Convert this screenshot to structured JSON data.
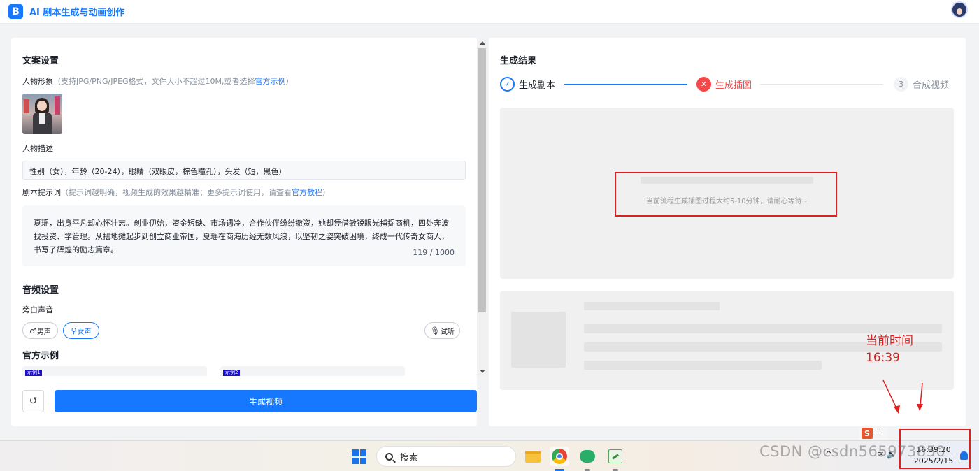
{
  "app": {
    "logo_letter": "B",
    "title": "AI 剧本生成与动画创作"
  },
  "left": {
    "copy_settings_title": "文案设置",
    "character_image_label": "人物形象",
    "character_image_hint": "（支持JPG/PNG/JPEG格式，文件大小不超过10M,或者选择",
    "character_image_link": "官方示例",
    "character_image_hint_end": "）",
    "character_desc_label": "人物描述",
    "character_desc_value": "性别（女），年龄（20-24），眼睛（双眼皮，棕色瞳孔），头发（短，黑色）",
    "prompt_label": "剧本提示词",
    "prompt_hint": "（提示词越明确，视频生成的效果越精准；更多提示词使用，请查看",
    "prompt_link": "官方教程",
    "prompt_hint_end": "）",
    "prompt_value": "夏瑶，出身平凡却心怀壮志。创业伊始，资金短缺、市场遇冷，合作伙伴纷纷撤资，她却凭借敏锐眼光捕捉商机，四处奔波找投资、学管理。从摆地摊起步到创立商业帝国，夏瑶在商海历经无数风浪，以坚韧之姿突破困境，终成一代传奇女商人，书写了辉煌的励志篇章。",
    "prompt_count": "119 / 1000",
    "audio_title": "音频设置",
    "narration_label": "旁白声音",
    "male_voice": "男声",
    "female_voice": "女声",
    "listen": "试听",
    "examples_title": "官方示例",
    "example_tags": [
      "示例1",
      "示例2"
    ],
    "generate_button": "生成视频"
  },
  "right": {
    "result_title": "生成结果",
    "steps": [
      {
        "label": "生成剧本",
        "status": "done"
      },
      {
        "label": "生成插图",
        "status": "error"
      },
      {
        "label": "合成视频",
        "status": "wait",
        "number": "3"
      }
    ],
    "wait_message": "当前流程生成插图过程大约5-10分钟，请耐心等待~"
  },
  "annotation": {
    "text_line1": "当前时间",
    "text_line2": "16:39"
  },
  "taskbar": {
    "search_placeholder": "搜索",
    "time": "16:39:20",
    "date": "2025/2/15"
  },
  "watermark": "CSDN @csdn565973850",
  "colors": {
    "accent": "#1677ff",
    "error": "#f5484a",
    "annotation": "#e02020"
  }
}
